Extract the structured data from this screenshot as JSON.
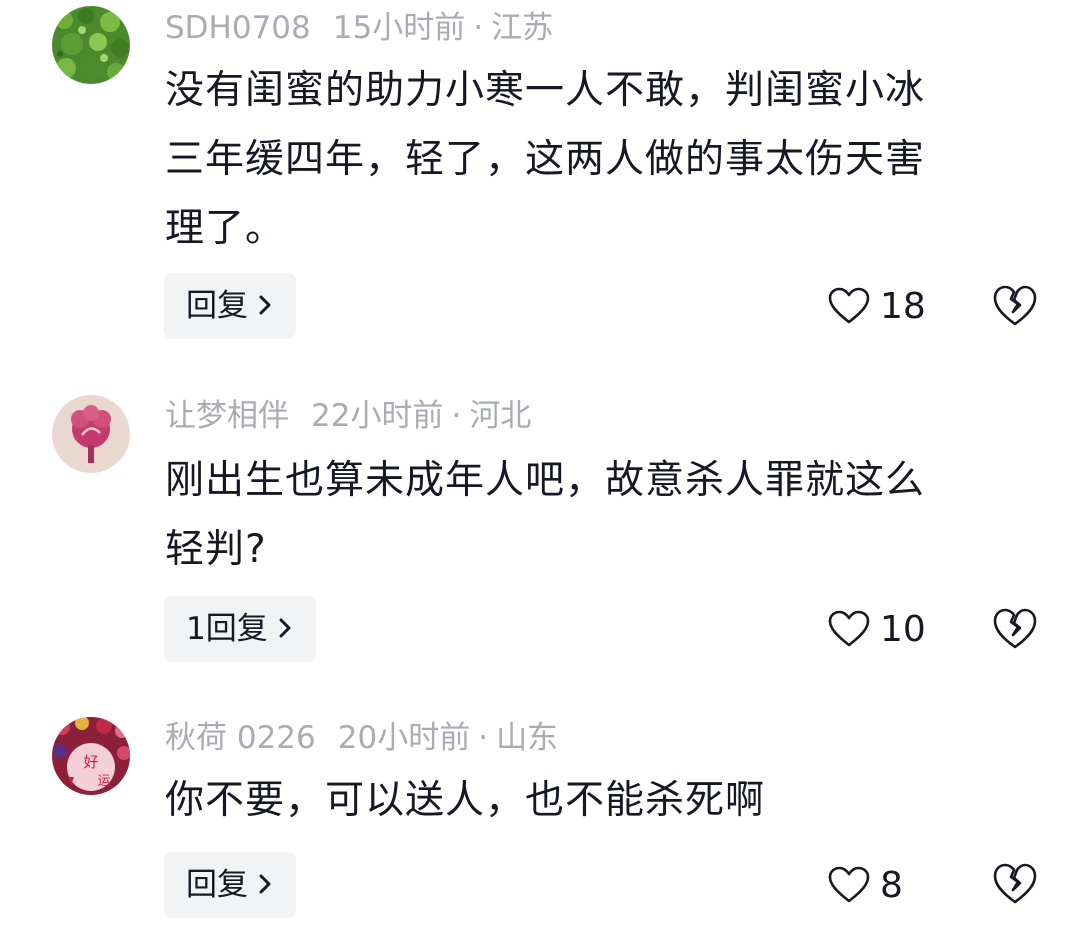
{
  "comments": [
    {
      "username": "SDH0708",
      "time": "15小时前",
      "separator": "·",
      "location": "江苏",
      "lines": [
        "没有闺蜜的助力小寒一人不敢，判闺蜜小冰",
        "三年缓四年，轻了，这两人做的事太伤天害",
        "理了。"
      ],
      "reply_label": "回复",
      "likes": "18",
      "avatar_icon": "green-leaves-avatar"
    },
    {
      "username": "让梦相伴",
      "time": "22小时前",
      "separator": "·",
      "location": "河北",
      "lines": [
        "刚出生也算未成年人吧，故意杀人罪就这么",
        "轻判?"
      ],
      "reply_label": "1回复",
      "likes": "10",
      "avatar_icon": "pink-flower-avatar"
    },
    {
      "username": "秋荷 0226",
      "time": "20小时前",
      "separator": "·",
      "location": "山东",
      "lines": [
        "你不要，可以送人，也不能杀死啊"
      ],
      "reply_label": "回复",
      "likes": "8",
      "avatar_icon": "good-luck-avatar",
      "avatar_text": [
        "好",
        "运"
      ]
    }
  ],
  "colors": {
    "text": "#161823",
    "meta": "#a9acb3",
    "reply_bg": "#f2f3f5"
  }
}
